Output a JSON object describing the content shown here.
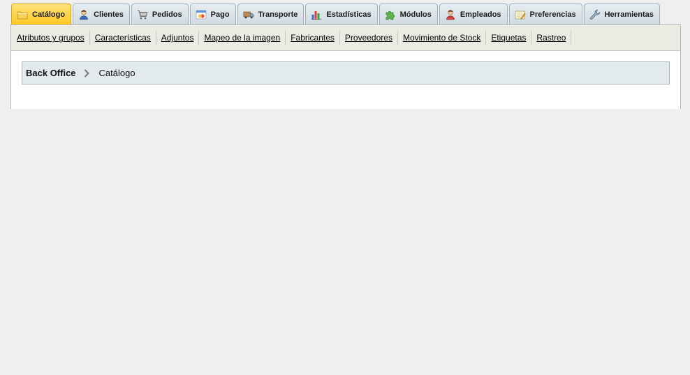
{
  "tabs": [
    {
      "label": "Catálogo",
      "icon": "folder-icon",
      "active": true
    },
    {
      "label": "Clientes",
      "icon": "customer-icon",
      "active": false
    },
    {
      "label": "Pedidos",
      "icon": "cart-icon",
      "active": false
    },
    {
      "label": "Pago",
      "icon": "payment-icon",
      "active": false
    },
    {
      "label": "Transporte",
      "icon": "truck-icon",
      "active": false
    },
    {
      "label": "Estadísticas",
      "icon": "bar-chart-icon",
      "active": false
    },
    {
      "label": "Módulos",
      "icon": "puzzle-icon",
      "active": false
    },
    {
      "label": "Empleados",
      "icon": "employee-icon",
      "active": false
    },
    {
      "label": "Preferencias",
      "icon": "preferences-icon",
      "active": false
    },
    {
      "label": "Herramientas",
      "icon": "wrench-icon",
      "active": false
    }
  ],
  "submenu": [
    "Atributos y grupos",
    "Características",
    "Adjuntos",
    "Mapeo de la imagen",
    "Fabricantes",
    "Proveedores",
    "Movimiento de Stock",
    "Etiquetas",
    "Rastreo"
  ],
  "breadcrumb": {
    "root": "Back Office",
    "current": "Catálogo",
    "separator_icon": "chevron-right-icon"
  },
  "colors": {
    "active_tab": "#ffc821",
    "inactive_tab": "#d7e1e7",
    "submenu_bg": "#ecebe3",
    "breadcrumb_bg": "#e2eaee",
    "page_bg": "#efefef"
  }
}
